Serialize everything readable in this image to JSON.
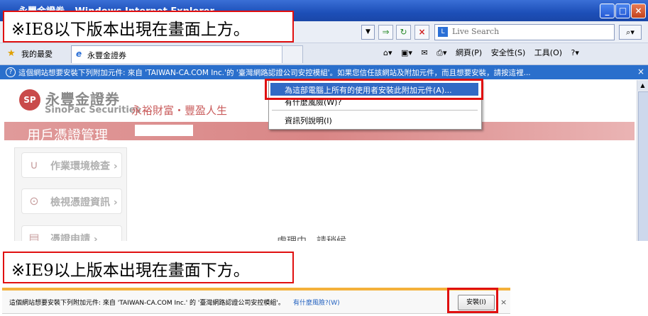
{
  "window": {
    "title": "永豐金證券 - Windows Internet Explorer",
    "minimize_icon": "minimize-icon",
    "maximize_icon": "maximize-icon",
    "close_icon": "close-icon"
  },
  "address_bar": {
    "search_placeholder": "Live Search",
    "icons": [
      "dropdown-icon",
      "go-icon",
      "refresh-icon",
      "stop-icon",
      "live-search-icon",
      "search-icon"
    ]
  },
  "tabs": {
    "favorites_label": "我的最愛",
    "active_tab_title": "永豐金證券"
  },
  "command_bar": {
    "items": [
      "網頁(P)",
      "安全性(S)",
      "工具(O)"
    ]
  },
  "info_bar": {
    "text": "這個網站想要安裝下列附加元件: 來自 'TAIWAN-CA.COM Inc.'的 '臺灣網路認證公司安控模組'。如果您信任該網站及附加元件，而且想要安裝，請按這裡...",
    "close": "×"
  },
  "context_menu": {
    "items": [
      "為這部電腦上所有的使用者安裝此附加元件(A)...",
      "有什麼風險(W)?",
      "資訊列說明(I)"
    ]
  },
  "page": {
    "logo_mark": "SP",
    "brand_name": "永豐金證券",
    "brand_en": "SinoPac Securities",
    "slogan": "永裕財富・豐盈人生",
    "banner_title": "用戶憑證管理",
    "nav": [
      "作業環境檢查 ›",
      "檢視憑證資訊 ›",
      "憑證申請 ›"
    ],
    "processing_text": "處理中，請稍候..."
  },
  "callouts": {
    "ie8": "※IE8以下版本出現在畫面上方。",
    "ie9": "※IE9以上版本出現在畫面下方。"
  },
  "ie9_bar": {
    "text": "這個網站想要安裝下列附加元件: 來自 'TAIWAN-CA.COM Inc.' 的 '臺灣網路認證公司安控模組'。",
    "risk_link": "有什麼風險?(W)",
    "install_button": "安裝(I)",
    "close": "×"
  },
  "colors": {
    "highlight_red": "#e01010",
    "info_bar_blue": "#2a6fcc",
    "menu_selected": "#316ac5",
    "brand_red": "#c94b4b",
    "ie9_accent": "#f4b13a"
  }
}
